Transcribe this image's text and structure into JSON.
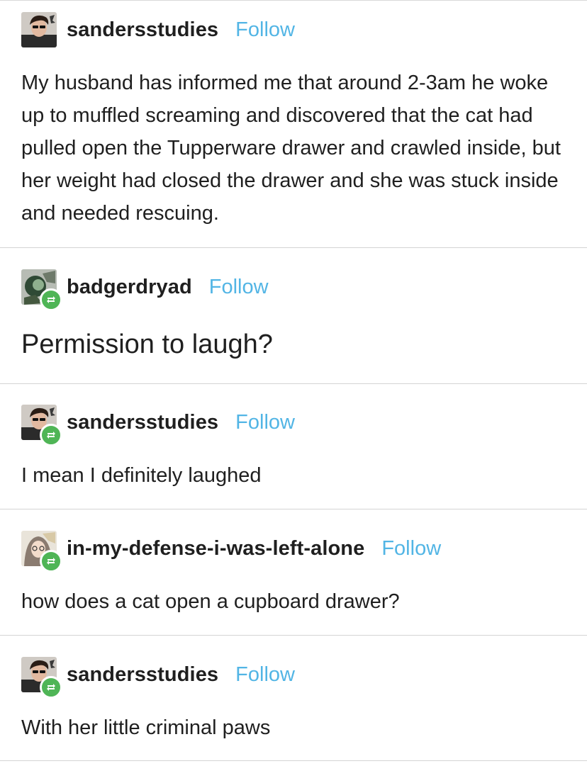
{
  "posts": [
    {
      "username": "sandersstudies",
      "follow_label": "Follow",
      "avatar_icon": "avatar-sandersstudies",
      "reblogged": false,
      "body": "My husband has informed me that around 2-3am he woke up to muffled screaming and discovered that the cat had pulled open the Tupperware drawer and crawled inside, but her weight had closed the drawer and she was stuck inside and needed rescuing."
    },
    {
      "username": "badgerdryad",
      "follow_label": "Follow",
      "avatar_icon": "avatar-badgerdryad",
      "reblogged": true,
      "body": "Permission to laugh?"
    },
    {
      "username": "sandersstudies",
      "follow_label": "Follow",
      "avatar_icon": "avatar-sandersstudies",
      "reblogged": true,
      "body": "I mean I definitely laughed"
    },
    {
      "username": "in-my-defense-i-was-left-alone",
      "follow_label": "Follow",
      "avatar_icon": "avatar-in-my-defense",
      "reblogged": true,
      "body": "how does a cat open a cupboard drawer?"
    },
    {
      "username": "sandersstudies",
      "follow_label": "Follow",
      "avatar_icon": "avatar-sandersstudies",
      "reblogged": true,
      "body": "With her little criminal paws"
    }
  ],
  "colors": {
    "follow_link": "#52b5e5",
    "reblog_badge": "#4fb556",
    "divider": "#d4d4d4",
    "text": "#1f1f1f"
  }
}
